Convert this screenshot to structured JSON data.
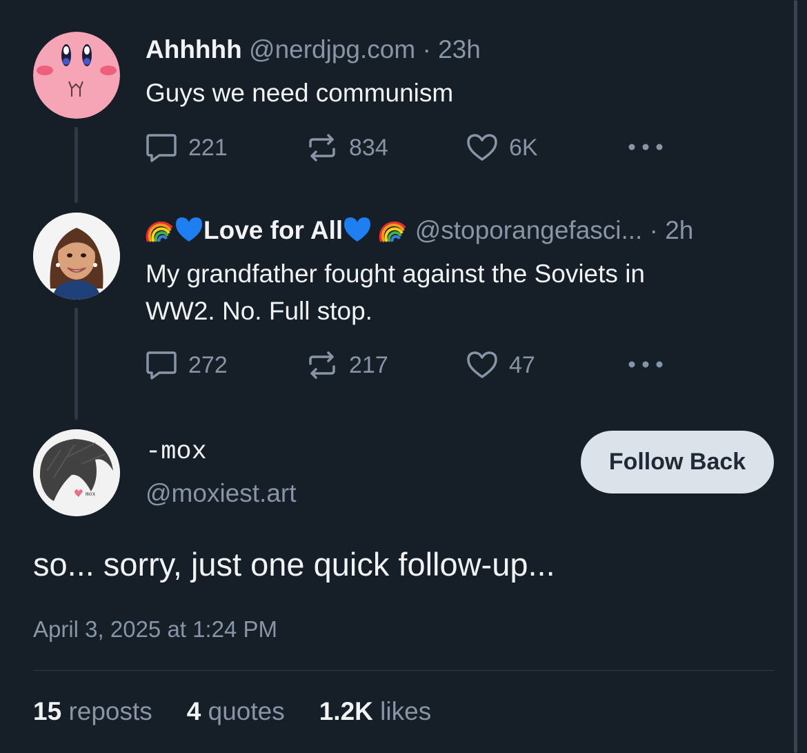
{
  "posts": [
    {
      "author_name": "Ahhhhh",
      "handle": "@nerdjpg.com",
      "separator": "·",
      "time": "23h",
      "text": "Guys we need communism",
      "replies": "221",
      "reposts": "834",
      "likes": "6K",
      "avatar_icon": "kirby-avatar"
    },
    {
      "author_name": "Love for All",
      "name_emoji_left": [
        "rainbow",
        "blue-heart"
      ],
      "name_emoji_right": [
        "blue-heart",
        "rainbow"
      ],
      "handle": "@stoporangefasci...",
      "separator": "·",
      "time": "2h",
      "text_line1": "My grandfather fought against the Soviets in",
      "text_line2": "WW2. No. Full stop.",
      "replies": "272",
      "reposts": "217",
      "likes": "47",
      "avatar_icon": "cartoon-portrait-avatar"
    }
  ],
  "main_post": {
    "author_name": "-mox",
    "handle": "@moxiest.art",
    "follow_label": "Follow Back",
    "text": "so... sorry, just one quick follow-up...",
    "date": "April 3, 2025 at 1:24 PM",
    "avatar_label": "mox",
    "stats": {
      "reposts_count": "15",
      "reposts_label": "reposts",
      "quotes_count": "4",
      "quotes_label": "quotes",
      "likes_count": "1.2K",
      "likes_label": "likes"
    }
  },
  "colors": {
    "background": "#161e27",
    "muted_text": "#8795a6",
    "primary_text": "#f1f3f5",
    "button_bg": "#dce2ea"
  }
}
